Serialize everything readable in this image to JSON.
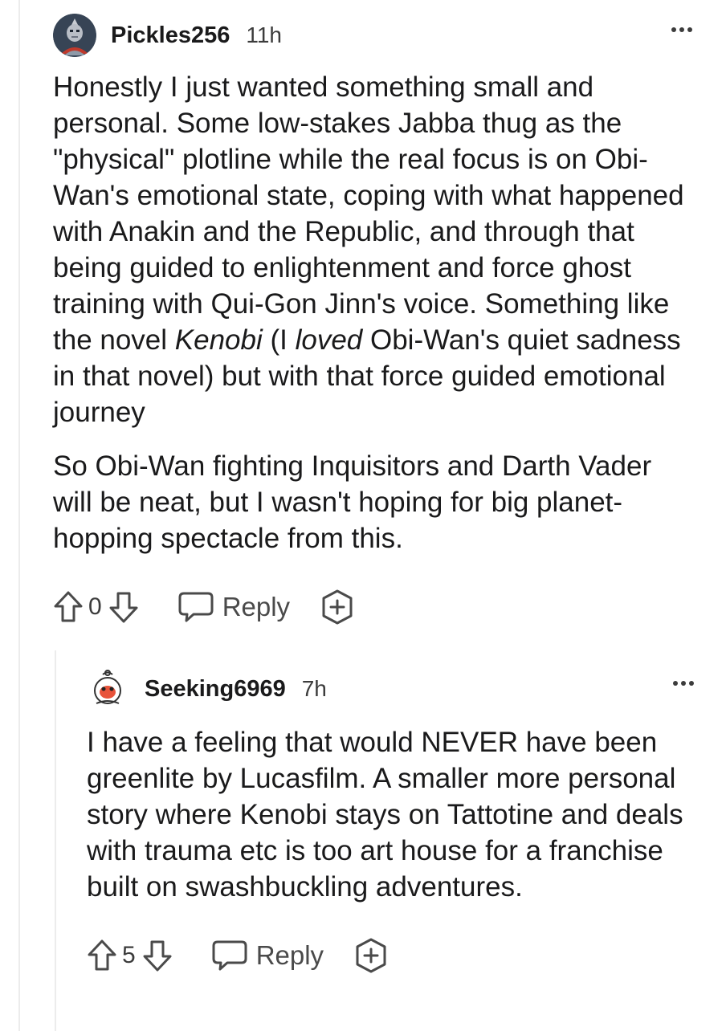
{
  "comments": [
    {
      "username": "Pickles256",
      "timestamp": "11h",
      "paragraphs": [
        {
          "before": "Honestly I just wanted something small and personal. Some low-stakes Jabba thug as the \"physical\" plotline while the real focus is on Obi-Wan's emotional state, coping with what happened with Anakin and the Republic, and through that being guided to enlightenment and force ghost training with Qui-Gon Jinn's voice. Something like the novel ",
          "italic1": "Kenobi",
          "middle": " (I ",
          "italic2": "loved",
          "after": " Obi-Wan's quiet sadness in that novel) but with that force guided emotional journey"
        },
        {
          "text": "So Obi-Wan fighting Inquisitors and Darth Vader will be neat, but I wasn't hoping for big planet-hopping spectacle from this."
        }
      ],
      "score": "0",
      "reply_label": "Reply"
    },
    {
      "username": "Seeking6969",
      "timestamp": "7h",
      "text": "I have a feeling that would NEVER have been greenlite by Lucasfilm. A smaller more personal story where Kenobi stays on Tattotine and deals with trauma etc is too art house for a franchise built on swashbuckling adventures.",
      "score": "5",
      "reply_label": "Reply"
    }
  ],
  "icons": {
    "upvote": "arrow-up-outline-icon",
    "downvote": "arrow-down-outline-icon",
    "reply": "speech-bubble-icon",
    "award": "plus-circle-icon",
    "more": "three-dots-icon"
  },
  "colors": {
    "text": "#1a1a1b",
    "meta": "#3c3c3c",
    "thread_line": "#ececec"
  }
}
